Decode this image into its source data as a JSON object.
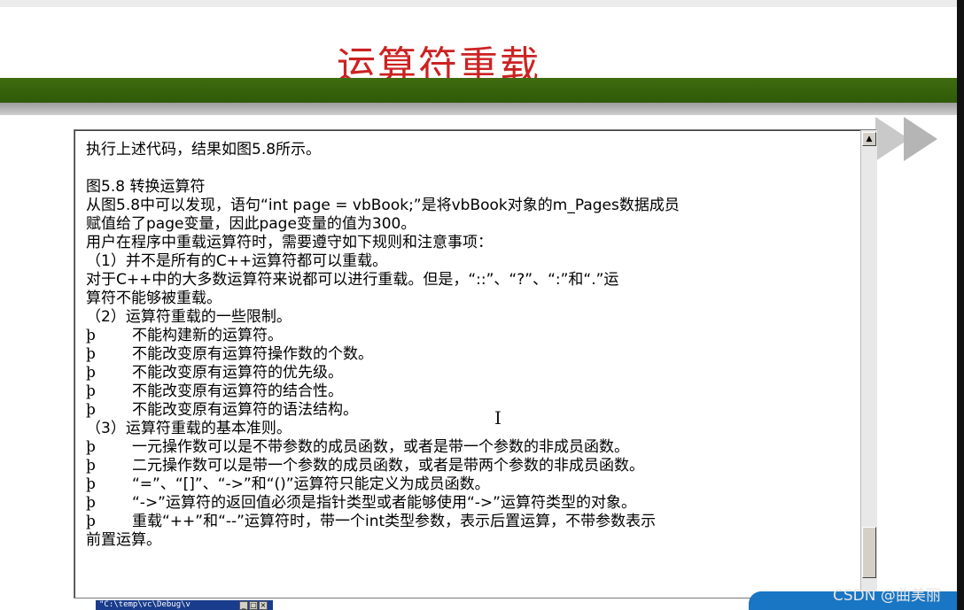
{
  "slide": {
    "title": "运算符重载"
  },
  "document": {
    "lines": [
      "执行上述代码，结果如图5.8所示。",
      "",
      "图5.8  转换运算符",
      "从图5.8中可以发现，语句“int page = vbBook;”是将vbBook对象的m_Pages数据成员",
      "赋值给了page变量，因此page变量的值为300。",
      "用户在程序中重载运算符时，需要遵守如下规则和注意事项：",
      "（1）并不是所有的C++运算符都可以重载。",
      "对于C++中的大多数运算符来说都可以进行重载。但是，“::”、“?”、“:”和“.”运",
      "算符不能够被重载。",
      "（2）运算符重载的一些限制。"
    ],
    "bullets_a": [
      {
        "mark": "þ",
        "text": "不能构建新的运算符。"
      },
      {
        "mark": "þ",
        "text": "不能改变原有运算符操作数的个数。"
      },
      {
        "mark": "þ",
        "text": "不能改变原有运算符的优先级。"
      },
      {
        "mark": "þ",
        "text": "不能改变原有运算符的结合性。"
      },
      {
        "mark": "þ",
        "text": "不能改变原有运算符的语法结构。"
      }
    ],
    "section3": "（3）运算符重载的基本准则。",
    "bullets_b": [
      {
        "mark": "þ",
        "text": "一元操作数可以是不带参数的成员函数，或者是带一个参数的非成员函数。"
      },
      {
        "mark": "þ",
        "text": "二元操作数可以是带一个参数的成员函数，或者是带两个参数的非成员函数。"
      },
      {
        "mark": "þ",
        "text": "“=”、“[]”、“->”和“()”运算符只能定义为成员函数。"
      },
      {
        "mark": "þ",
        "text": "“->”运算符的返回值必须是指针类型或者能够使用“->”运算符类型的对象。"
      },
      {
        "mark": "þ",
        "text": "重载“++”和“--”运算符时，带一个int类型参数，表示后置运算，不带参数表示"
      }
    ],
    "last_line": "前置运算。"
  },
  "scrollbar": {
    "up_icon": "arrow-up-icon",
    "thumb_position_fraction": 0.9
  },
  "taskbar": {
    "window_label": "\"C:\\temp\\vc\\Debug\\v",
    "buttons": [
      "_",
      "□",
      "×"
    ]
  },
  "watermark": "CSDN @曲美丽",
  "colors": {
    "title": "#cc2222",
    "bar_dark": "#3f6b10",
    "taskbar": "#1a3c8c",
    "blue_shape": "#1976c4"
  }
}
